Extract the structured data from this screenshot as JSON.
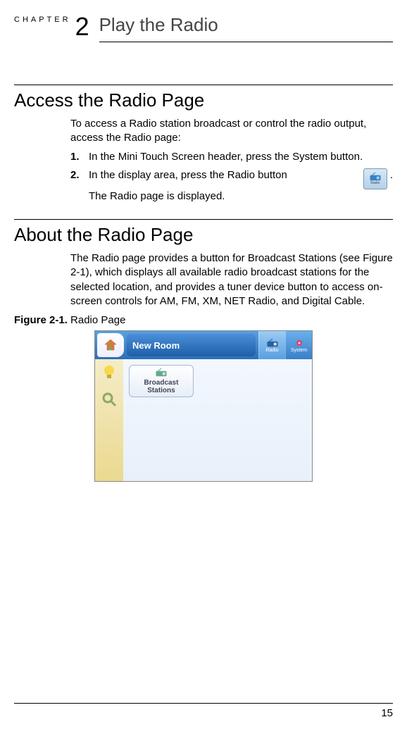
{
  "chapter": {
    "label": "CHAPTER",
    "number": "2",
    "title": "Play the Radio"
  },
  "section1": {
    "title": "Access the Radio Page",
    "intro": "To access a Radio station broadcast or control the radio output, access the Radio page:",
    "steps": [
      {
        "num": "1.",
        "text": "In the Mini Touch Screen header, press the System button."
      },
      {
        "num": "2.",
        "line1": "In the display area, press the Radio button",
        "dot": ".",
        "line2": "The Radio page is displayed."
      }
    ],
    "radio_icon_label": "Radio"
  },
  "section2": {
    "title": "About the Radio Page",
    "body": "The Radio page provides a button for Broadcast Stations (see Figure 2-1), which displays all available radio broadcast stations for the selected location, and provides a tuner device button to access on-screen controls for AM, FM, XM, NET Radio, and Digital Cable."
  },
  "figure": {
    "caption_bold": "Figure 2-1.",
    "caption_rest": " Radio Page",
    "tab_label": "New Room",
    "top_radio": "Radio",
    "top_system": "System",
    "broadcast_line1": "Broadcast",
    "broadcast_line2": "Stations"
  },
  "page_number": "15",
  "icons": {
    "home": "home-icon",
    "bulb": "bulb-icon",
    "mag": "magnifier-icon",
    "radio": "radio-icon",
    "gear": "gear-icon"
  }
}
